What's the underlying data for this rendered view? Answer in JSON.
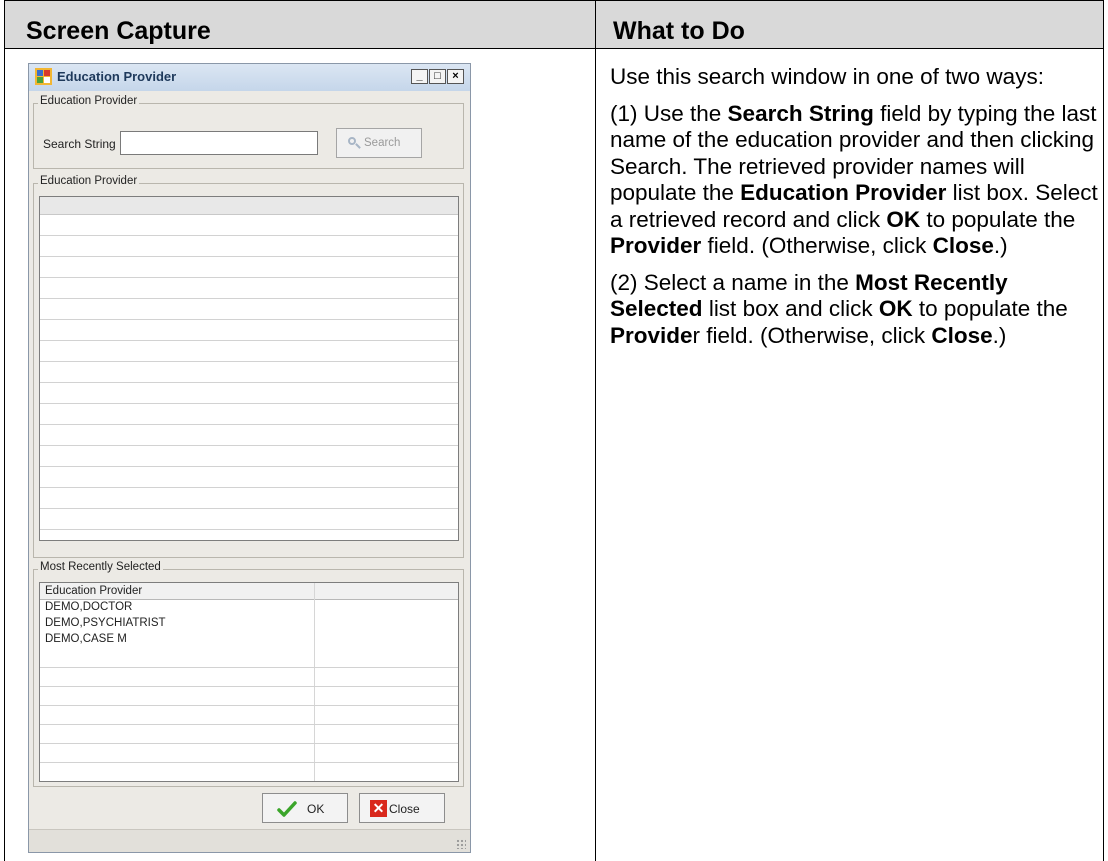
{
  "table": {
    "col1_header": "Screen Capture",
    "col2_header": "What to Do"
  },
  "window": {
    "title": "Education Provider",
    "search_group_label": "Education Provider",
    "search_label": "Search String",
    "search_value": "",
    "search_button": "Search",
    "results_group_label": "Education Provider",
    "recent_group_label": "Most Recently Selected",
    "recent_column_header": "Education Provider",
    "recent_rows": [
      "DEMO,DOCTOR",
      "DEMO,PSYCHIATRIST",
      "DEMO,CASE M"
    ],
    "ok_button": "OK",
    "close_button": "Close",
    "min_glyph": "_",
    "max_glyph": "□",
    "close_glyph": "×"
  },
  "instructions": {
    "p1": "Use this search window in one of two ways:",
    "p2": {
      "a": "(1) Use the ",
      "b": "Search String",
      "c": " field by typing the last name of the education provider and then clicking Search. The retrieved provider names will populate the ",
      "d": "Education Provider",
      "e": " list box. Select a retrieved record and click ",
      "f": "OK",
      "g": " to populate the ",
      "h": "Provider",
      "i": " field. (Otherwise, click ",
      "j": "Close",
      "k": ".)"
    },
    "p3": {
      "a": "(2) Select a name in the ",
      "b": "Most Recently Selected",
      "c": " list box and click ",
      "d": "OK",
      "e": " to populate the ",
      "f": "Provide",
      "g": "r field. (Otherwise, click ",
      "h": "Close",
      "i": ".)"
    }
  },
  "icons": {
    "ok": "check-icon",
    "close": "red-x-icon",
    "search": "magnifier-icon",
    "app": "app-icon"
  },
  "colors": {
    "header_bg": "#d9d9d9",
    "window_bg": "#eceae5",
    "titlebar_text": "#1e395b",
    "ok_check": "#3aa52a",
    "close_red": "#d9281c"
  }
}
